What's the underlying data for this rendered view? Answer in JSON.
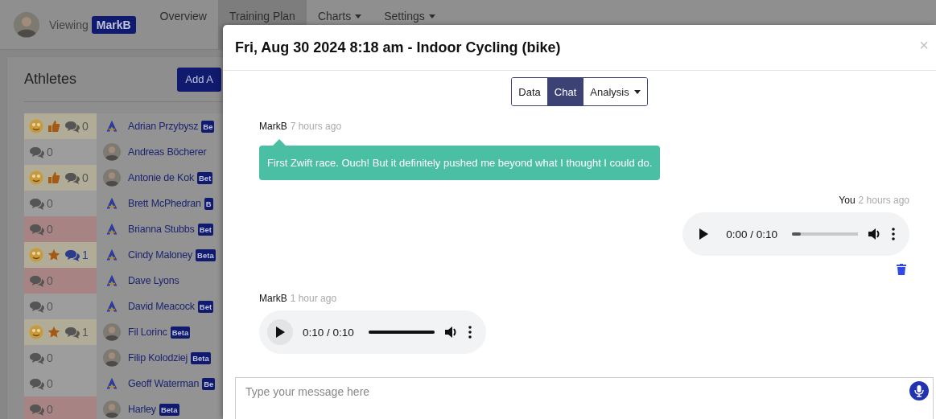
{
  "header": {
    "viewing_label": "Viewing",
    "user_badge": "MarkB",
    "nav": [
      {
        "label": "Overview",
        "selected": false,
        "dropdown": false
      },
      {
        "label": "Training Plan",
        "selected": true,
        "dropdown": false
      },
      {
        "label": "Charts",
        "selected": false,
        "dropdown": true
      },
      {
        "label": "Settings",
        "selected": false,
        "dropdown": true
      }
    ]
  },
  "athletes": {
    "title": "Athletes",
    "add_button": "Add A",
    "rows": [
      {
        "reactions": [
          {
            "kind": "face"
          },
          {
            "kind": "thumbs_up"
          }
        ],
        "chat_count": "0",
        "chat_unread": false,
        "color": "#b1ac98",
        "avatar": {
          "kind": "logo"
        },
        "name": "Adrian Przybysz",
        "badge": "Be"
      },
      {
        "reactions": [],
        "chat_count": "0",
        "chat_unread": false,
        "color": "#9d9d9d",
        "avatar": {
          "kind": "photo"
        },
        "name": "Andreas Böcherer"
      },
      {
        "reactions": [
          {
            "kind": "face"
          },
          {
            "kind": "thumbs_up"
          }
        ],
        "chat_count": "0",
        "chat_unread": false,
        "color": "#b1ac98",
        "avatar": {
          "kind": "photo"
        },
        "name": "Antonie de Kok",
        "badge": "Bet"
      },
      {
        "reactions": [],
        "chat_count": "0",
        "chat_unread": false,
        "color": "#9d9d9d",
        "avatar": {
          "kind": "logo"
        },
        "name": "Brett McPhedran",
        "badge": "B"
      },
      {
        "reactions": [],
        "chat_count": "0",
        "chat_unread": false,
        "color": "#a78383",
        "avatar": {
          "kind": "logo"
        },
        "name": "Brianna Stubbs",
        "badge": "Bet"
      },
      {
        "reactions": [
          {
            "kind": "face"
          },
          {
            "kind": "star"
          }
        ],
        "chat_count": "1",
        "chat_unread": true,
        "color": "#b1ac98",
        "avatar": {
          "kind": "logo"
        },
        "name": "Cindy Maloney",
        "badge": "Beta"
      },
      {
        "reactions": [],
        "chat_count": "0",
        "chat_unread": false,
        "color": "#a78383",
        "avatar": {
          "kind": "logo"
        },
        "name": "Dave Lyons"
      },
      {
        "reactions": [],
        "chat_count": "0",
        "chat_unread": false,
        "color": "#9d9d9d",
        "avatar": {
          "kind": "logo"
        },
        "name": "David Meacock",
        "badge": "Bet"
      },
      {
        "reactions": [
          {
            "kind": "face"
          },
          {
            "kind": "star"
          }
        ],
        "chat_count": "1",
        "chat_unread": false,
        "color": "#b1ac98",
        "avatar": {
          "kind": "photo"
        },
        "name": "Fil Lorinc",
        "badge": "Beta"
      },
      {
        "reactions": [],
        "chat_count": "0",
        "chat_unread": false,
        "color": "#9d9d9d",
        "avatar": {
          "kind": "photo"
        },
        "name": "Filip Kolodziej",
        "badge": "Beta"
      },
      {
        "reactions": [],
        "chat_count": "0",
        "chat_unread": false,
        "color": "#9d9d9d",
        "avatar": {
          "kind": "logo"
        },
        "name": "Geoff Waterman",
        "badge": "Be"
      },
      {
        "reactions": [],
        "chat_count": "0",
        "chat_unread": false,
        "color": "#a78383",
        "avatar": {
          "kind": "photo"
        },
        "name": "Harley",
        "badge": "Beta"
      }
    ]
  },
  "modal": {
    "title": "Fri, Aug 30 2024 8:18 am - Indoor Cycling (bike)",
    "close": "×",
    "tabs": [
      {
        "label": "Data",
        "selected": false,
        "dropdown": false
      },
      {
        "label": "Chat",
        "selected": true,
        "dropdown": false
      },
      {
        "label": "Analysis",
        "selected": false,
        "dropdown": true
      }
    ],
    "messages": [
      {
        "kind": "text",
        "mine": false,
        "author": "MarkB",
        "time": "7 hours ago",
        "text": "First Zwift race. Ouch! But it definitely pushed me beyond what I thought I could do."
      },
      {
        "kind": "audio",
        "mine": true,
        "author": "You",
        "time": "2 hours ago",
        "position": "0:00 / 0:10",
        "level": 0.13,
        "deletable": true
      },
      {
        "kind": "audio",
        "mine": false,
        "author": "MarkB",
        "time": "1 hour ago",
        "position": "0:10 / 0:10",
        "level": 1,
        "deletable": false
      }
    ],
    "composer": {
      "placeholder": "Type your message here"
    }
  }
}
